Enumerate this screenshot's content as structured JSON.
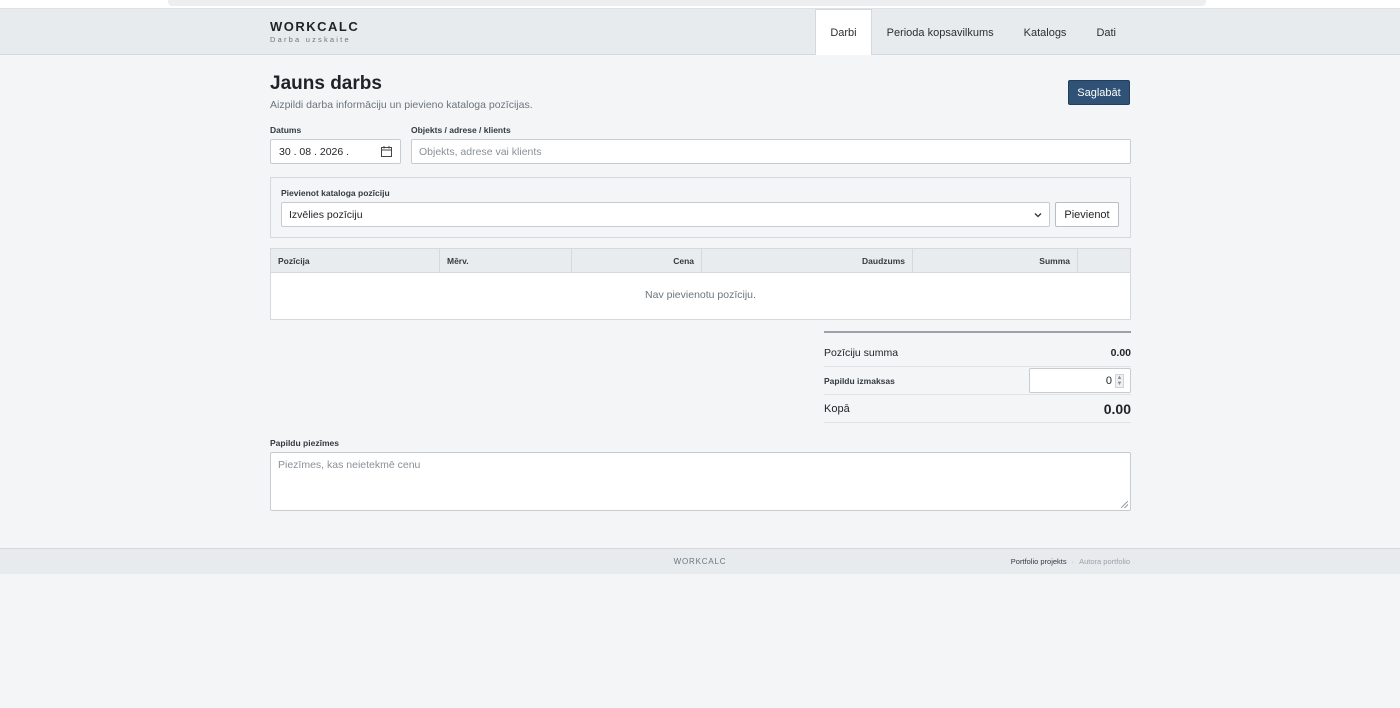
{
  "header": {
    "brand_name": "WORKCALC",
    "brand_sub": "Darba uzskaite",
    "nav": [
      "Darbi",
      "Perioda kopsavilkums",
      "Katalogs",
      "Dati"
    ],
    "active_nav": "Darbi"
  },
  "page": {
    "title": "Jauns darbs",
    "subtitle": "Aizpildi darba informāciju un pievieno kataloga pozīcijas.",
    "save_label": "Saglabāt"
  },
  "form": {
    "date_label": "Datums",
    "date_value": "30 . 08 . 2026 .",
    "object_label": "Objekts / adrese / klients",
    "object_placeholder": "Objekts, adrese vai klients"
  },
  "catalog": {
    "label": "Pievienot kataloga pozīciju",
    "select_value": "Izvēlies pozīciju",
    "add_label": "Pievienot"
  },
  "table": {
    "columns": [
      "Pozīcija",
      "Mērv.",
      "Cena",
      "Daudzums",
      "Summa",
      ""
    ],
    "empty_text": "Nav pievienotu pozīciju."
  },
  "totals": {
    "items_label": "Pozīciju summa",
    "items_value": "0.00",
    "extra_label": "Papildu izmaksas",
    "extra_value": "0",
    "total_label": "Kopā",
    "total_value": "0.00"
  },
  "notes": {
    "label": "Papildu piezīmes",
    "placeholder": "Piezīmes, kas neietekmē cenu"
  },
  "footer": {
    "brand": "WORKCALC",
    "link1": "Portfolio projekts",
    "separator": "·",
    "link2": "Autora portfolio"
  },
  "icons": {
    "calendar": "calendar-icon",
    "chevron": "chevron-down-icon",
    "spinner": "number-spinner-icon"
  },
  "colors": {
    "primary_button": "#2f5276",
    "header_bg": "#e8ebee",
    "page_bg": "#f3f5f6"
  }
}
